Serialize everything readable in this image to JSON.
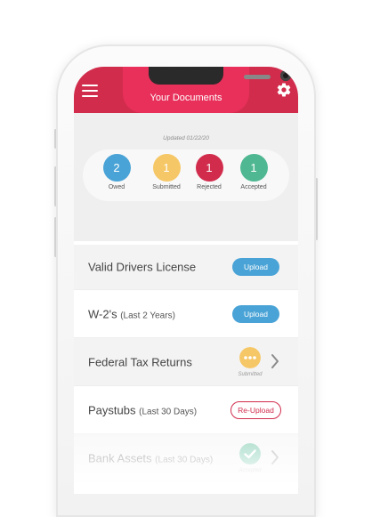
{
  "header": {
    "title": "Your Documents"
  },
  "summary": {
    "updated": "Updated 01/22/20",
    "stats": [
      {
        "count": "2",
        "label": "Owed",
        "color": "#4aa3d6"
      },
      {
        "count": "1",
        "label": "Submitted",
        "color": "#f6c766"
      },
      {
        "count": "1",
        "label": "Rejected",
        "color": "#d12c4c"
      },
      {
        "count": "1",
        "label": "Accepted",
        "color": "#4fb892"
      }
    ]
  },
  "documents": [
    {
      "title": "Valid Drivers License",
      "subtitle": "",
      "action": "Upload"
    },
    {
      "title": "W-2's",
      "subtitle": "(Last 2 Years)",
      "action": "Upload"
    },
    {
      "title": "Federal Tax Returns",
      "subtitle": "",
      "status": "Submitted",
      "status_icon": "ellipsis-icon"
    },
    {
      "title": "Paystubs",
      "subtitle": "(Last 30 Days)",
      "action": "Re-Upload"
    },
    {
      "title": "Bank Assets",
      "subtitle": "(Last 30 Days)",
      "status": "Accepted",
      "status_icon": "check-icon"
    }
  ],
  "colors": {
    "brand": "#d12c4c",
    "brand_tab": "#e8305a",
    "upload": "#4aa3d6",
    "submitted": "#f6c766",
    "accepted": "#4fb892"
  }
}
